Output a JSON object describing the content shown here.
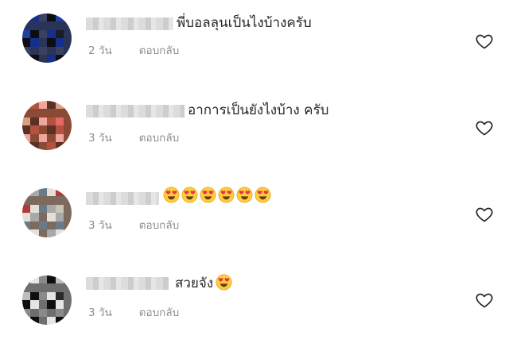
{
  "comments": [
    {
      "text": "พี่บอลลุนเป็นไงบ้างครับ",
      "age": "2 วัน",
      "reply_label": "ตอบกลับ",
      "emoji_count": 0,
      "avatar_colors": [
        "#1c1c24",
        "#2a3358",
        "#1d3fa6",
        "#0d0d12",
        "#3a4060",
        "#15308a"
      ]
    },
    {
      "text": "อาการเป็นยังไงบ้าง ครับ",
      "age": "3 วัน",
      "reply_label": "ตอบกลับ",
      "emoji_count": 0,
      "avatar_colors": [
        "#e46b63",
        "#8a4a34",
        "#d8a083",
        "#5a3126",
        "#f0a69c",
        "#b5523f"
      ]
    },
    {
      "text": "",
      "age": "3 วัน",
      "reply_label": "ตอบกลับ",
      "emoji_count": 6,
      "avatar_colors": [
        "#c9c3b6",
        "#7d6a5e",
        "#b33a3a",
        "#e4e0d8",
        "#6b7a88",
        "#a8a8a8"
      ]
    },
    {
      "text": "สวยจัง",
      "age": "3 วัน",
      "reply_label": "ตอบกลับ",
      "emoji_count": 1,
      "avatar_colors": [
        "#2a2a2a",
        "#6e6e6e",
        "#bdbdbd",
        "#0f0f0f",
        "#8a8a8a",
        "#e5e5e5"
      ]
    }
  ],
  "emoji_name": "heart-eyes-emoji",
  "like_icon": "heart-outline-icon",
  "colors": {
    "text": "#262626",
    "meta": "#8e8e8e",
    "emoji_face": "#ffcc3e",
    "emoji_heart": "#e8334a"
  }
}
